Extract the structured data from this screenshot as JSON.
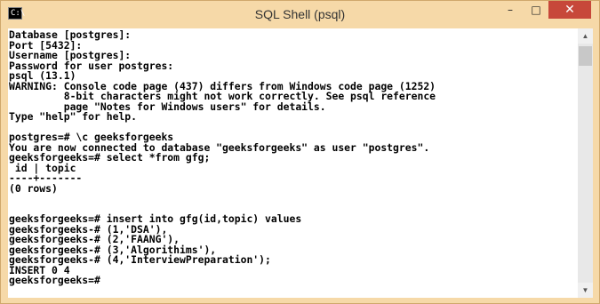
{
  "window": {
    "title": "SQL Shell (psql)",
    "icon_text": "C:\\",
    "minimize_icon": "minimize-icon",
    "maximize_icon": "maximize-icon",
    "close_icon": "close-icon"
  },
  "console": {
    "lines": [
      "Database [postgres]:",
      "Port [5432]:",
      "Username [postgres]:",
      "Password for user postgres:",
      "psql (13.1)",
      "WARNING: Console code page (437) differs from Windows code page (1252)",
      "         8-bit characters might not work correctly. See psql reference",
      "         page \"Notes for Windows users\" for details.",
      "Type \"help\" for help.",
      "",
      "postgres=# \\c geeksforgeeks",
      "You are now connected to database \"geeksforgeeks\" as user \"postgres\".",
      "geeksforgeeks=# select *from gfg;",
      " id | topic",
      "----+-------",
      "(0 rows)",
      "",
      "",
      "geeksforgeeks=# insert into gfg(id,topic) values",
      "geeksforgeeks-# (1,'DSA'),",
      "geeksforgeeks-# (2,'FAANG'),",
      "geeksforgeeks-# (3,'Algorithims'),",
      "geeksforgeeks-# (4,'InterviewPreparation');",
      "INSERT 0 4",
      "geeksforgeeks=#"
    ]
  },
  "scrollbar": {
    "up_icon": "scroll-up-arrow",
    "down_icon": "scroll-down-arrow"
  }
}
